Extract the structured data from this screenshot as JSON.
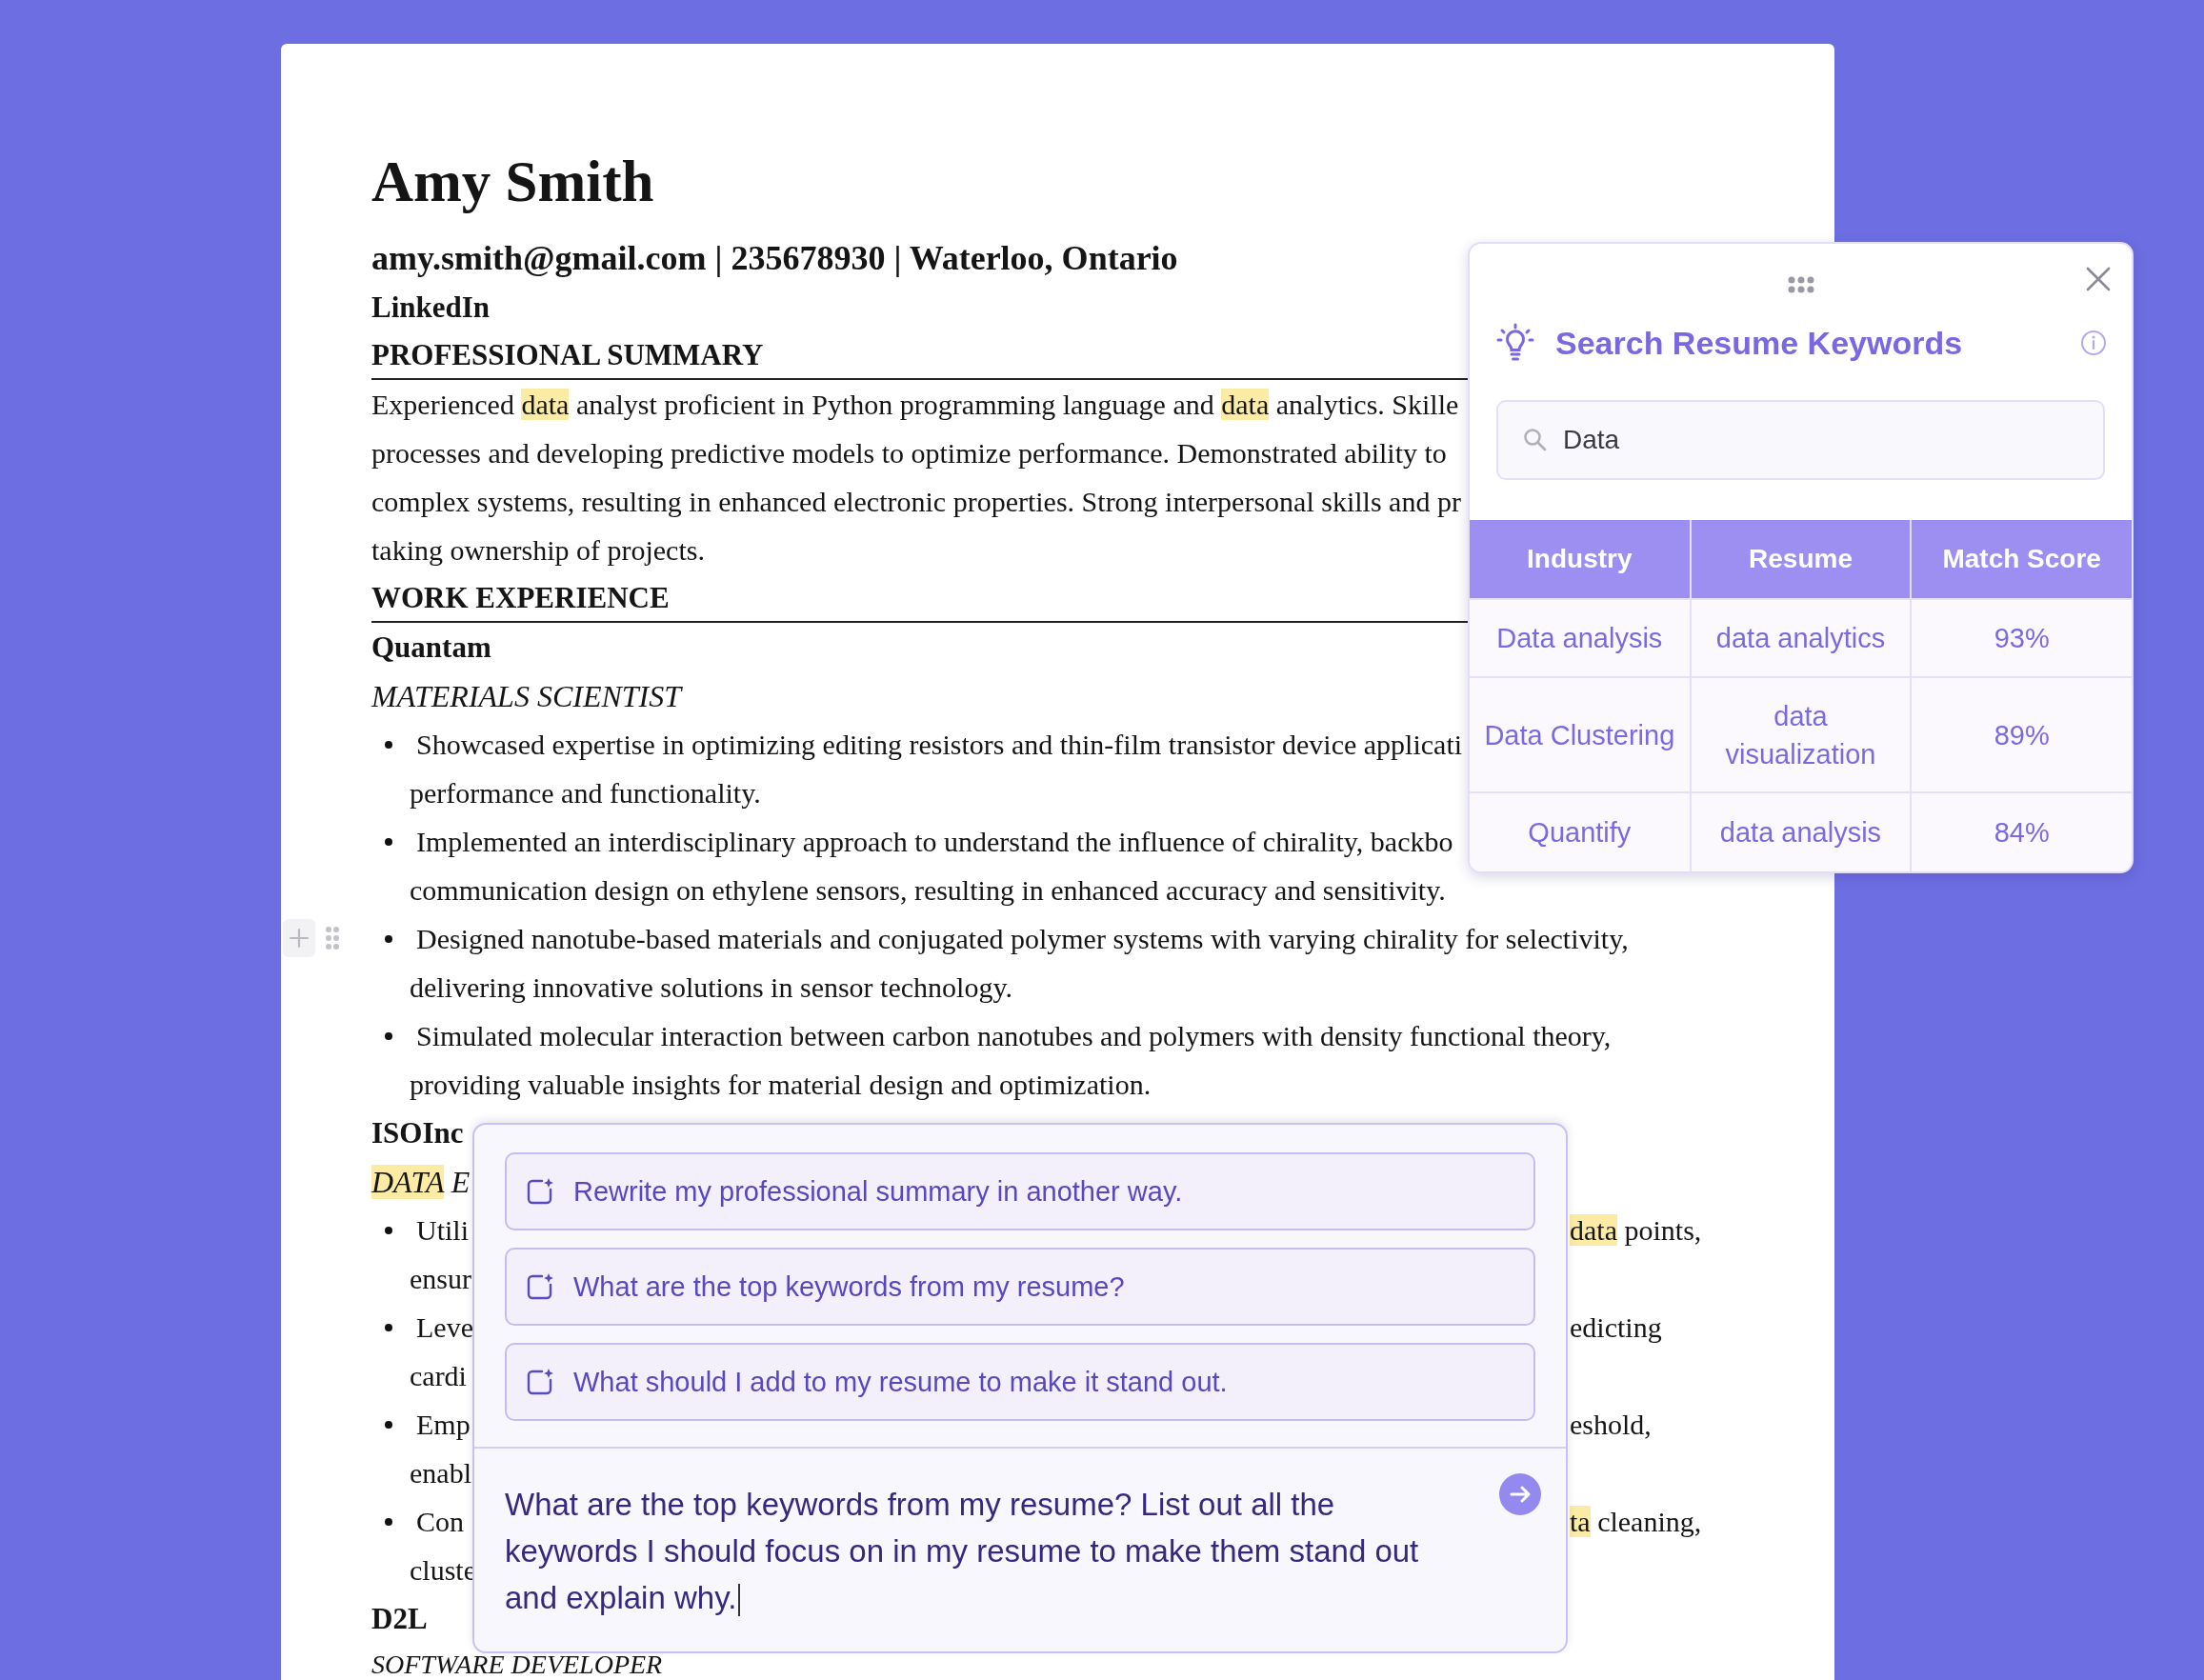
{
  "resume": {
    "lines": [
      {
        "kind": "name",
        "segments": [
          {
            "text": "Amy Smith",
            "highlight": false
          }
        ]
      },
      {
        "kind": "contact",
        "segments": [
          {
            "text": "amy.smith@gmail.com | 235678930 | Waterloo, Ontario",
            "highlight": false
          }
        ]
      },
      {
        "kind": "link",
        "segments": [
          {
            "text": "LinkedIn",
            "highlight": false
          }
        ]
      },
      {
        "kind": "heading",
        "segments": [
          {
            "text": "PROFESSIONAL SUMMARY",
            "highlight": false
          }
        ]
      },
      {
        "kind": "text",
        "segments": [
          {
            "text": "Experienced ",
            "highlight": false
          },
          {
            "text": "data",
            "highlight": true
          },
          {
            "text": " analyst proficient in Python programming language and ",
            "highlight": false
          },
          {
            "text": "data",
            "highlight": true
          },
          {
            "text": " analytics. Skille",
            "highlight": false
          }
        ]
      },
      {
        "kind": "text",
        "segments": [
          {
            "text": "processes and developing predictive models to optimize performance. Demonstrated ability to",
            "highlight": false
          }
        ]
      },
      {
        "kind": "text",
        "segments": [
          {
            "text": "complex systems, resulting in enhanced electronic properties. Strong interpersonal skills and pr",
            "highlight": false
          }
        ]
      },
      {
        "kind": "text",
        "segments": [
          {
            "text": "taking ownership of projects.",
            "highlight": false
          }
        ]
      },
      {
        "kind": "heading",
        "segments": [
          {
            "text": "WORK EXPERIENCE",
            "highlight": false
          }
        ]
      },
      {
        "kind": "company",
        "segments": [
          {
            "text": "Quantam",
            "highlight": false
          }
        ]
      },
      {
        "kind": "role",
        "segments": [
          {
            "text": "MATERIALS SCIENTIST",
            "highlight": false
          }
        ]
      },
      {
        "kind": "bullet",
        "segments": [
          {
            "text": "Showcased expertise in optimizing editing resistors and thin-film transistor device applicati",
            "highlight": false
          }
        ]
      },
      {
        "kind": "continuation",
        "segments": [
          {
            "text": "performance and functionality.",
            "highlight": false
          }
        ]
      },
      {
        "kind": "bullet",
        "segments": [
          {
            "text": "Implemented an interdisciplinary approach to understand the influence of chirality, backbo",
            "highlight": false
          }
        ]
      },
      {
        "kind": "continuation",
        "segments": [
          {
            "text": "communication design on ethylene sensors, resulting in enhanced accuracy and sensitivity.",
            "highlight": false
          }
        ]
      },
      {
        "kind": "bullet",
        "block_handles": true,
        "segments": [
          {
            "text": "Designed nanotube-based materials and conjugated polymer systems with varying chirality for selectivity,",
            "highlight": false
          }
        ]
      },
      {
        "kind": "continuation",
        "segments": [
          {
            "text": "delivering innovative solutions in sensor technology.",
            "highlight": false
          }
        ]
      },
      {
        "kind": "bullet",
        "segments": [
          {
            "text": "Simulated molecular interaction between carbon nanotubes and polymers with density functional theory,",
            "highlight": false
          }
        ]
      },
      {
        "kind": "continuation",
        "segments": [
          {
            "text": "providing valuable insights for material design and optimization.",
            "highlight": false
          }
        ]
      },
      {
        "kind": "company",
        "segments": [
          {
            "text": "ISOInc",
            "highlight": false
          }
        ]
      },
      {
        "kind": "role",
        "segments": [
          {
            "text": "DATA",
            "highlight": true
          },
          {
            "text": " E",
            "highlight": false
          }
        ]
      },
      {
        "kind": "bullet",
        "segments": [
          {
            "text": "Utili",
            "highlight": false
          }
        ],
        "right": [
          {
            "text": "data",
            "highlight": true
          },
          {
            "text": " points,",
            "highlight": false
          }
        ]
      },
      {
        "kind": "continuation",
        "segments": [
          {
            "text": "ensur",
            "highlight": false
          }
        ]
      },
      {
        "kind": "bullet",
        "segments": [
          {
            "text": "Leve",
            "highlight": false
          }
        ],
        "right": [
          {
            "text": "edicting",
            "highlight": false
          }
        ]
      },
      {
        "kind": "continuation",
        "segments": [
          {
            "text": "cardi",
            "highlight": false
          }
        ]
      },
      {
        "kind": "bullet",
        "segments": [
          {
            "text": "Emp",
            "highlight": false
          }
        ],
        "right": [
          {
            "text": "eshold,",
            "highlight": false
          }
        ]
      },
      {
        "kind": "continuation",
        "segments": [
          {
            "text": "enabl",
            "highlight": false
          }
        ]
      },
      {
        "kind": "bullet",
        "segments": [
          {
            "text": "Con",
            "highlight": false
          }
        ],
        "right": [
          {
            "text": "ta",
            "highlight": true
          },
          {
            "text": " cleaning,",
            "highlight": false
          }
        ]
      },
      {
        "kind": "continuation",
        "segments": [
          {
            "text": "cluste",
            "highlight": false
          }
        ]
      },
      {
        "kind": "company",
        "segments": [
          {
            "text": "D2L",
            "highlight": false
          }
        ]
      },
      {
        "kind": "role",
        "segments": [
          {
            "text": "SOFTWARE DEVELOPER",
            "highlight": false
          }
        ]
      }
    ]
  },
  "keyword_panel": {
    "title": "Search Resume Keywords",
    "search": {
      "value": "Data"
    },
    "table": {
      "columns": [
        "Industry",
        "Resume",
        "Match Score"
      ],
      "rows": [
        [
          "Data analysis",
          "data analytics",
          "93%"
        ],
        [
          "Data Clustering",
          "data visualization",
          "89%"
        ],
        [
          "Quantify",
          "data analysis",
          "84%"
        ]
      ]
    }
  },
  "assistant": {
    "suggestions": [
      "Rewrite my professional summary in another way.",
      "What are the top keywords from my resume?",
      "What should I add to my resume to make it stand out."
    ],
    "message": {
      "value": "What are the top keywords from my resume? List out all the keywords I should focus on in my resume to make them stand out and explain why."
    }
  }
}
